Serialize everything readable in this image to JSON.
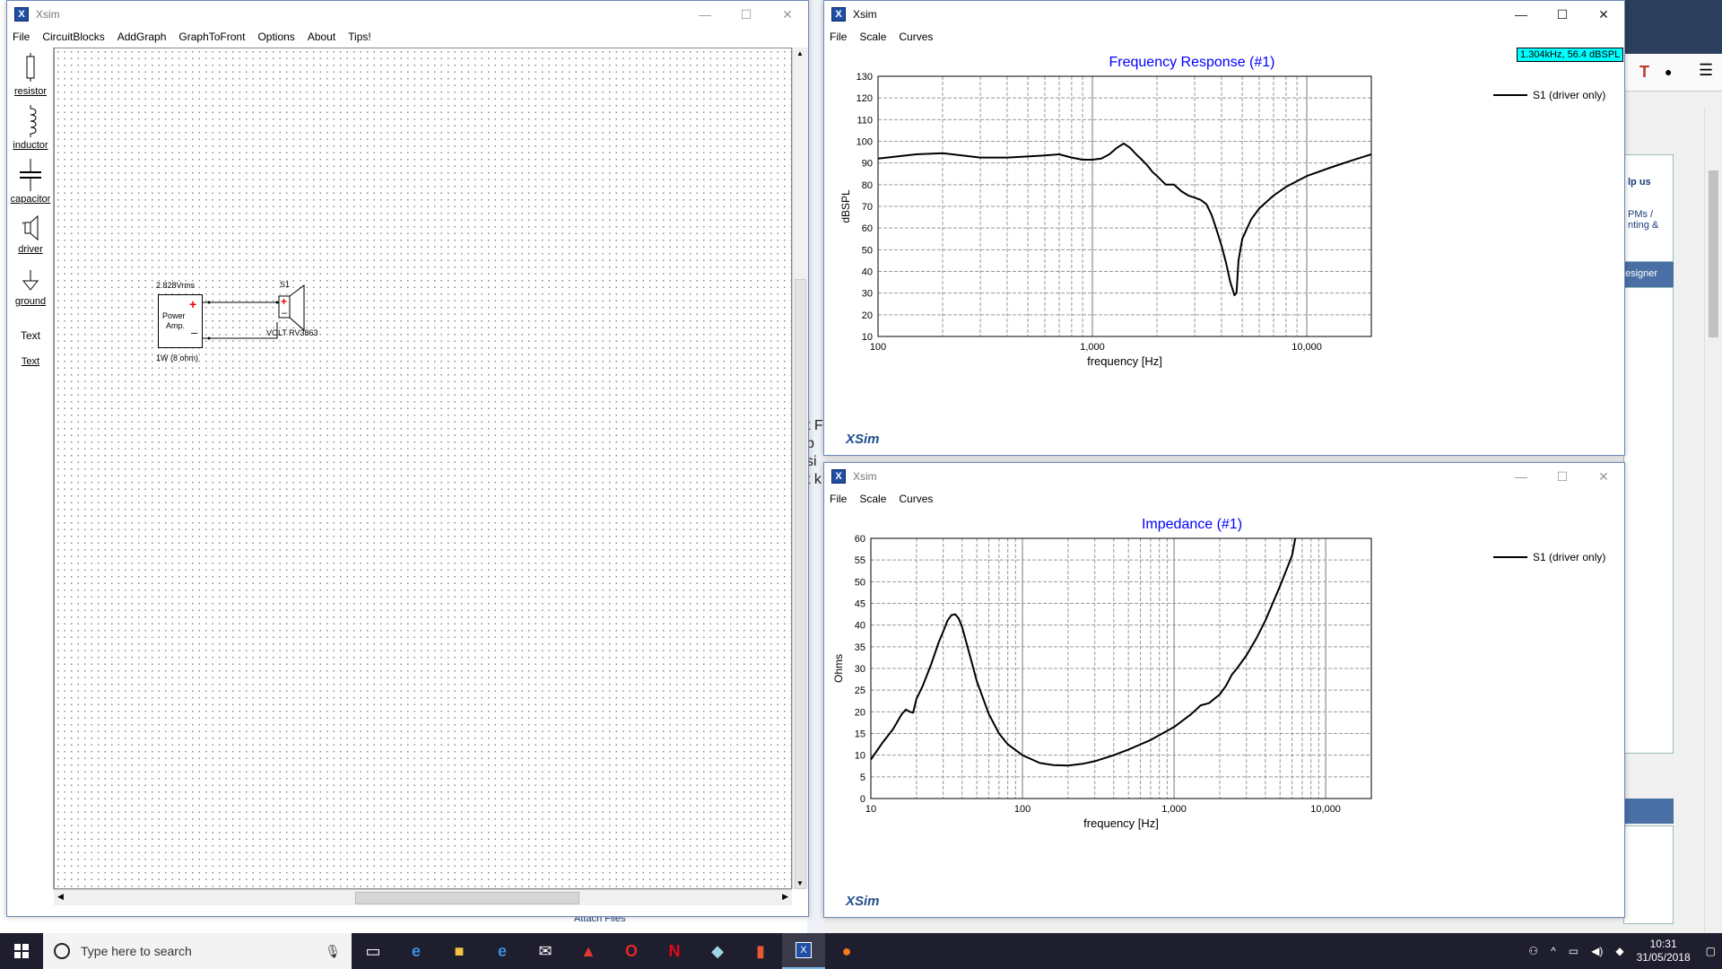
{
  "circuit_window": {
    "title": "Xsim",
    "menu": [
      "File",
      "CircuitBlocks",
      "AddGraph",
      "GraphToFront",
      "Options",
      "About",
      "Tips!"
    ],
    "palette": [
      {
        "label": "resistor",
        "icon": "resistor-icon"
      },
      {
        "label": "inductor",
        "icon": "inductor-icon"
      },
      {
        "label": "capacitor",
        "icon": "capacitor-icon"
      },
      {
        "label": "driver",
        "icon": "driver-icon"
      },
      {
        "label": "ground",
        "icon": "ground-icon"
      },
      {
        "label": "Text",
        "icon": "text-icon"
      },
      {
        "label": "Text",
        "icon": "text-icon"
      }
    ],
    "circuit": {
      "amp_voltage": "2.828Vrms",
      "amp_label_1": "Power",
      "amp_label_2": "Amp.",
      "amp_power": "1W (8 ohm)",
      "speaker_name": "S1",
      "speaker_model": "VOLT RV3863"
    }
  },
  "freq_window": {
    "title": "Xsim",
    "menu": [
      "File",
      "Scale",
      "Curves"
    ],
    "readout": "1.304kHz, 56.4 dBSPL",
    "brand": "XSim",
    "chart_data": {
      "type": "line",
      "title": "Frequency Response (#1)",
      "xlabel": "frequency [Hz]",
      "ylabel": "dBSPL",
      "xscale": "log",
      "xlim": [
        100,
        20000
      ],
      "ylim": [
        10,
        130
      ],
      "x_ticks": [
        "100",
        "1,000",
        "10,000"
      ],
      "y_ticks": [
        "10",
        "20",
        "30",
        "40",
        "50",
        "60",
        "70",
        "80",
        "90",
        "100",
        "110",
        "120",
        "130"
      ],
      "grid": true,
      "legend_position": "right",
      "series": [
        {
          "name": "S1 (driver only)",
          "x": [
            100,
            150,
            200,
            300,
            400,
            500,
            600,
            700,
            800,
            900,
            1000,
            1100,
            1200,
            1300,
            1400,
            1500,
            1600,
            1700,
            1800,
            1900,
            2000,
            2200,
            2400,
            2600,
            2800,
            3000,
            3200,
            3400,
            3600,
            3800,
            4000,
            4200,
            4400,
            4600,
            4700,
            4800,
            5000,
            5500,
            6000,
            7000,
            8000,
            10000,
            13000,
            16000,
            20000
          ],
          "y": [
            92,
            94,
            94.5,
            92.5,
            92.5,
            93,
            93.5,
            94,
            92.5,
            91.5,
            91.5,
            92,
            94,
            97,
            99,
            97,
            94,
            91.5,
            89,
            86,
            84,
            80,
            80,
            77,
            75,
            74,
            73,
            71,
            66,
            59,
            52,
            44,
            35,
            29,
            30,
            45,
            55,
            64,
            69,
            75,
            79,
            84,
            88,
            91,
            94
          ]
        }
      ]
    }
  },
  "imp_window": {
    "title": "Xsim",
    "menu": [
      "File",
      "Scale",
      "Curves"
    ],
    "brand": "XSim",
    "chart_data": {
      "type": "line",
      "title": "Impedance (#1)",
      "xlabel": "frequency [Hz]",
      "ylabel": "Ohms",
      "xscale": "log",
      "xlim": [
        10,
        20000
      ],
      "ylim": [
        0,
        60
      ],
      "x_ticks": [
        "10",
        "100",
        "1,000",
        "10,000"
      ],
      "y_ticks": [
        "0",
        "5",
        "10",
        "15",
        "20",
        "25",
        "30",
        "35",
        "40",
        "45",
        "50",
        "55",
        "60"
      ],
      "grid": true,
      "legend_position": "right",
      "series": [
        {
          "name": "S1 (driver only)",
          "x": [
            10,
            12,
            14,
            16,
            17,
            18,
            19,
            20,
            22,
            25,
            28,
            30,
            32,
            34,
            36,
            38,
            40,
            45,
            50,
            60,
            70,
            80,
            100,
            130,
            160,
            200,
            250,
            300,
            400,
            500,
            700,
            1000,
            1300,
            1500,
            1700,
            2000,
            2200,
            2400,
            2600,
            3000,
            3500,
            4000,
            5000,
            6000,
            6300
          ],
          "y": [
            9,
            13,
            16,
            19.5,
            20.5,
            20,
            19.8,
            23,
            26,
            31,
            36,
            38.5,
            41,
            42.3,
            42.5,
            41.5,
            39.5,
            33,
            27,
            19.5,
            15,
            12.5,
            10,
            8.2,
            7.7,
            7.6,
            8,
            8.6,
            10,
            11.3,
            13.5,
            16.5,
            19.5,
            21.5,
            22,
            24,
            26,
            28.5,
            30,
            33,
            37,
            41,
            49,
            56,
            60
          ]
        }
      ]
    }
  },
  "taskbar": {
    "search_placeholder": "Type here to search",
    "time": "10:31",
    "date": "31/05/2018"
  },
  "background": {
    "frag1": "t F",
    "frag2": "b",
    "frag3": "si",
    "frag4": "t k",
    "link_text": "Attach Files",
    "side_text_1": "lp us",
    "side_text_2": "PMs /",
    "side_text_3": "nting &",
    "side_text_4": "esigner"
  }
}
